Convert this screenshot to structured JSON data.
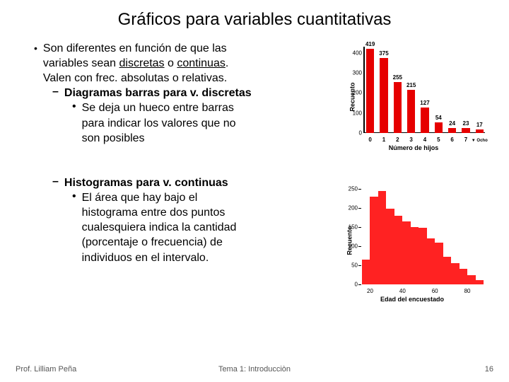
{
  "title": "Gráficos para variables cuantitativas",
  "intro": {
    "line1": "Son diferentes en función de que las",
    "line2a": "variables sean ",
    "line2b": "discretas",
    "line2c": " o ",
    "line2d": "continuas",
    "line2e": ".",
    "line3": "Valen con frec. absolutas o relativas.",
    "sub1": "Diagramas barras para v. discretas",
    "sub1_1a": "Se deja un hueco entre barras",
    "sub1_1b": "para indicar los valores que no",
    "sub1_1c": "son posibles"
  },
  "histo": {
    "sub2": "Histogramas para v. continuas",
    "sub2_1a": "El área que hay bajo el",
    "sub2_1b": "histograma entre dos puntos",
    "sub2_1c": "cualesquiera indica la cantidad",
    "sub2_1d": "(porcentaje o frecuencia) de",
    "sub2_1e": "individuos en el intervalo."
  },
  "footer": {
    "left": "Prof. Lilliam Peña",
    "mid": "Tema 1: Introducciòn",
    "right": "16"
  },
  "chart_data": [
    {
      "type": "bar",
      "categories": [
        "0",
        "1",
        "2",
        "3",
        "4",
        "5",
        "6",
        "7",
        "Ocho o más"
      ],
      "values": [
        419,
        375,
        255,
        215,
        127,
        54,
        24,
        23,
        17
      ],
      "xlabel": "Número de hijos",
      "ylabel": "Recuento",
      "yticks": [
        0,
        100,
        200,
        300,
        400
      ],
      "ylim": [
        0,
        430
      ]
    },
    {
      "type": "histogram",
      "xlabel": "Edad del encuestado",
      "ylabel": "Recuento",
      "xticks": [
        20,
        40,
        60,
        80
      ],
      "yticks": [
        0,
        50,
        100,
        150,
        200,
        250
      ],
      "ylim": [
        0,
        260
      ],
      "xlim": [
        15,
        90
      ],
      "bin_heights": [
        65,
        230,
        245,
        198,
        180,
        165,
        150,
        148,
        120,
        110,
        72,
        55,
        40,
        25,
        12
      ]
    }
  ]
}
